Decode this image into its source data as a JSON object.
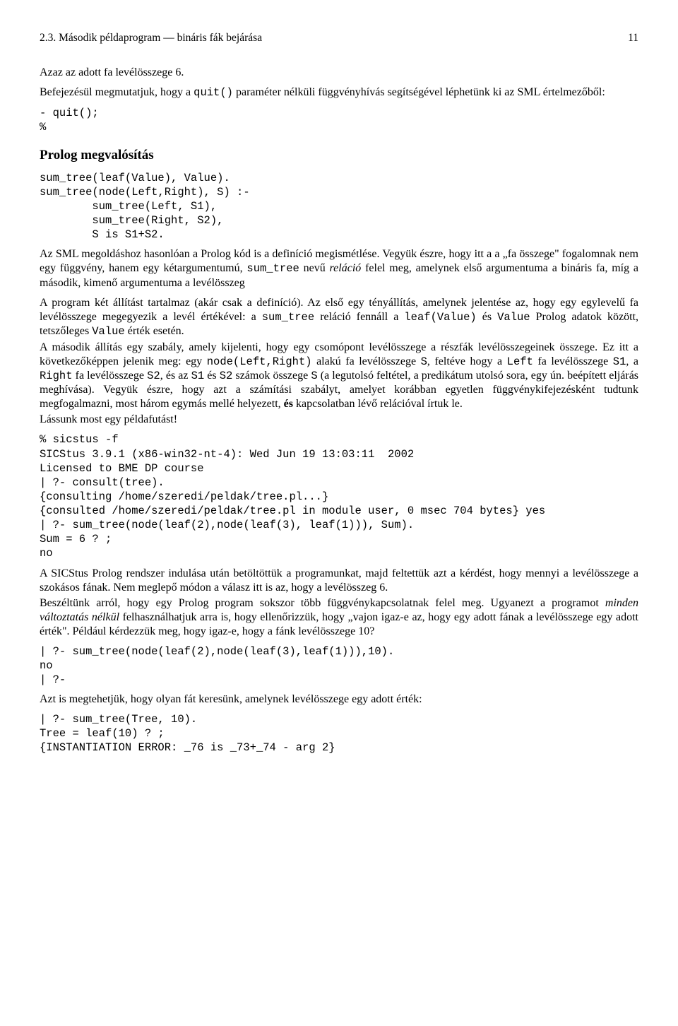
{
  "header": {
    "section_number": "2.3.",
    "section_title": "Második példaprogram — bináris fák bejárása",
    "page_number": "11"
  },
  "p1": "Azaz az adott fa levélösszege 6.",
  "p2a": "Befejezésül megmutatjuk, hogy a ",
  "p2_code": "quit()",
  "p2b": " paraméter nélküli függvényhívás segítségével léphetünk ki az SML értelmezőből:",
  "code_quit": "- quit();\n%",
  "heading_prolog": "Prolog megvalósítás",
  "code_sumtree": "sum_tree(leaf(Value), Value).\nsum_tree(node(Left,Right), S) :-\n        sum_tree(Left, S1),\n        sum_tree(Right, S2),\n        S is S1+S2.",
  "p3a": "Az SML megoldáshoz hasonlóan a Prolog kód is a definíció megismétlése.  Vegyük észre, hogy itt a a „fa összege\" fogalomnak nem egy függvény, hanem egy kétargumentumú, ",
  "p3_code": "sum_tree",
  "p3b": " nevű ",
  "p3_em": "reláció",
  "p3c": " felel meg, amelynek első argumentuma a bináris fa, míg a második, kimenő argumentuma a levélösszeg",
  "p4a": "A program két állítást tartalmaz (akár csak a definíció).  Az első egy tényállítás, amelynek jelentése az, hogy egy egylevelű fa levélösszege megegyezik a levél értékével: a ",
  "p4_code1": "sum_tree",
  "p4b": " reláció fennáll a ",
  "p4_code2": "leaf(Value)",
  "p4c": " és ",
  "p4_code3": "Value",
  "p4d": " Prolog adatok között, tetszőleges ",
  "p4_code4": "Value",
  "p4e": " érték esetén.",
  "p5a": "A második állítás egy szabály, amely kijelenti, hogy egy csomópont levélösszege a részfák levélösszegeinek összege.  Ez itt a következőképpen jelenik meg:  egy ",
  "p5_code1": "node(Left,Right)",
  "p5b": " alakú fa levélösszege ",
  "p5_code2": "S",
  "p5c": ", feltéve hogy a ",
  "p5_code3": "Left",
  "p5d": " fa levélösszege ",
  "p5_code4": "S1",
  "p5e": ", a ",
  "p5_code5": "Right",
  "p5f": " fa levélösszege ",
  "p5_code6": "S2",
  "p5g": ", és az ",
  "p5_code7": "S1",
  "p5h": " és ",
  "p5_code8": "S2",
  "p5i": " számok összege ",
  "p5_code9": "S",
  "p5j": " (a legutolsó feltétel, a predikátum utolsó sora, egy ún. beépített eljárás meghívása). Vegyük észre, hogy azt a számítási szabályt, amelyet korábban egyetlen függvénykifejezésként tudtunk megfogalmazni, most három egymás mellé helyezett, ",
  "p5_bold": "és",
  "p5k": " kapcsolatban lévő relációval írtuk le.",
  "p6": "Lássunk most egy példafutást!",
  "code_run1": "% sicstus -f\nSICStus 3.9.1 (x86-win32-nt-4): Wed Jun 19 13:03:11  2002\nLicensed to BME DP course\n| ?- consult(tree).\n{consulting /home/szeredi/peldak/tree.pl...}\n{consulted /home/szeredi/peldak/tree.pl in module user, 0 msec 704 bytes} yes\n| ?- sum_tree(node(leaf(2),node(leaf(3), leaf(1))), Sum).\nSum = 6 ? ;\nno",
  "p7": "A SICStus Prolog rendszer indulása után betöltöttük a programunkat, majd feltettük azt a kérdést, hogy mennyi a levélösszege a szokásos fának. Nem meglepő módon a válasz itt is az, hogy a levélösszeg 6.",
  "p8a": "Beszéltünk arról, hogy egy Prolog program sokszor több függvénykapcsolatnak felel meg. Ugyanezt a programot ",
  "p8_em": "minden változtatás nélkül",
  "p8b": " felhasználhatjuk arra is, hogy ellenőrizzük, hogy „vajon igaz-e az, hogy egy adott fának a levélösszege egy adott érték\".  Például kérdezzük meg, hogy igaz-e, hogy a fánk levélösszege 10?",
  "code_run2": "| ?- sum_tree(node(leaf(2),node(leaf(3),leaf(1))),10).\nno\n| ?-",
  "p9": "Azt is megtehetjük, hogy olyan fát keresünk, amelynek levélösszege egy adott érték:",
  "code_run3": "| ?- sum_tree(Tree, 10).\nTree = leaf(10) ? ;\n{INSTANTIATION ERROR: _76 is _73+_74 - arg 2}"
}
